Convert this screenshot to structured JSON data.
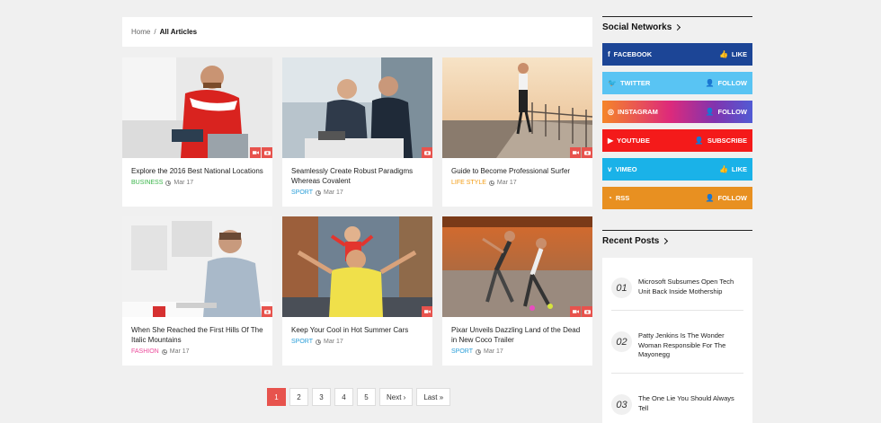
{
  "breadcrumb": {
    "home": "Home",
    "separator": "/",
    "current": "All Articles"
  },
  "articles": [
    {
      "title": "Explore the 2016 Best National Locations",
      "category": "BUSINESS",
      "cat_color": "#3ab54a",
      "date": "Mar 17"
    },
    {
      "title": "Seamlessly Create Robust Paradigms Whereas Covalent",
      "category": "SPORT",
      "cat_color": "#2b9fd9",
      "date": "Mar 17"
    },
    {
      "title": "Guide to Become Professional Surfer",
      "category": "LIFE STYLE",
      "cat_color": "#f39c12",
      "date": "Mar 17"
    },
    {
      "title": "When She Reached the First Hills Of The Italic Mountains",
      "category": "FASHION",
      "cat_color": "#ec4b9b",
      "date": "Mar 17"
    },
    {
      "title": "Keep Your Cool in Hot Summer Cars",
      "category": "SPORT",
      "cat_color": "#2b9fd9",
      "date": "Mar 17"
    },
    {
      "title": "Pixar Unveils Dazzling Land of the Dead in New Coco Trailer",
      "category": "SPORT",
      "cat_color": "#2b9fd9",
      "date": "Mar 17"
    }
  ],
  "pagination": {
    "pages": [
      "1",
      "2",
      "3",
      "4",
      "5"
    ],
    "next": "Next ›",
    "last": "Last »",
    "active": "1"
  },
  "sidebar": {
    "social_title": "Social Networks",
    "social": [
      {
        "name": "FACEBOOK",
        "action": "LIKE",
        "icon": "facebook-icon",
        "color": "#1c4596"
      },
      {
        "name": "TWITTER",
        "action": "FOLLOW",
        "icon": "twitter-icon",
        "color": "#59c4f3"
      },
      {
        "name": "INSTAGRAM",
        "action": "FOLLOW",
        "icon": "instagram-icon",
        "color": "#e74c6e"
      },
      {
        "name": "YOUTUBE",
        "action": "SUBSCRIBE",
        "icon": "youtube-icon",
        "color": "#f41a1a"
      },
      {
        "name": "VIMEO",
        "action": "LIKE",
        "icon": "vimeo-icon",
        "color": "#1ab2e8"
      },
      {
        "name": "RSS",
        "action": "FOLLOW",
        "icon": "rss-icon",
        "color": "#e89021"
      }
    ],
    "recent_title": "Recent Posts",
    "recent": [
      {
        "num": "01",
        "title": "Microsoft Subsumes Open Tech Unit Back Inside Mothership"
      },
      {
        "num": "02",
        "title": "Patty Jenkins Is The Wonder Woman Responsible For The Mayonegg"
      },
      {
        "num": "03",
        "title": "The One Lie You Should Always Tell"
      }
    ]
  }
}
